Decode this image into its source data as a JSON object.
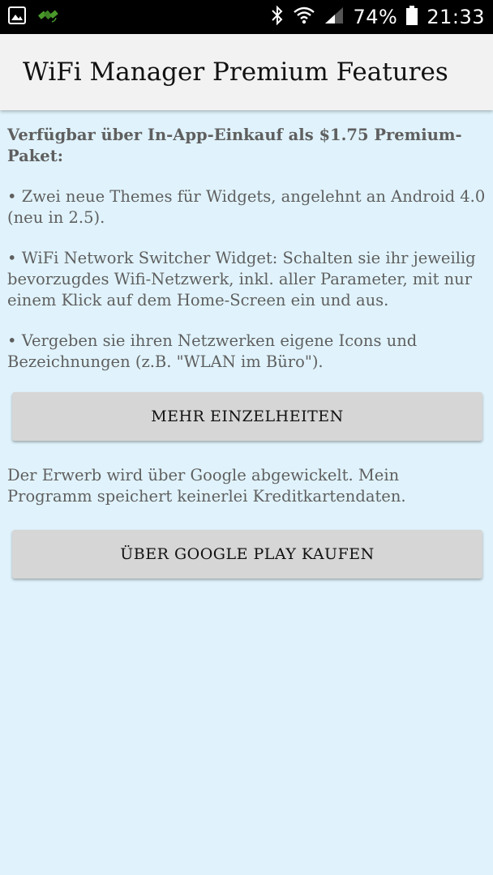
{
  "status_bar": {
    "icons_left": [
      "image-icon",
      "satellite-icon"
    ],
    "icons_right": [
      "bluetooth-icon",
      "wifi-icon",
      "signal-icon",
      "battery-icon"
    ],
    "battery": "74%",
    "time": "21:33"
  },
  "app_bar": {
    "title": "WiFi Manager Premium Features"
  },
  "content": {
    "intro": "Verfügbar über In-App-Einkauf als $1.75 Premium-Paket:",
    "features": [
      "• Zwei neue Themes für Widgets, angelehnt an Android 4.0 (neu in 2.5).",
      "• WiFi Network Switcher Widget: Schalten sie ihr jeweilig bevorzugdes Wifi-Netzwerk, inkl. aller Parameter, mit nur einem Klick auf dem Home-Screen ein und aus.",
      "• Vergeben sie ihren Netzwerken eigene Icons und Bezeichnungen (z.B. \"WLAN im Büro\")."
    ],
    "more_button": "MEHR EINZELHEITEN",
    "note": "Der Erwerb wird über Google abgewickelt. Mein Programm speichert keinerlei Kreditkartendaten.",
    "buy_button": "ÜBER GOOGLE PLAY KAUFEN"
  },
  "colors": {
    "background": "#e0f3fc",
    "app_bar": "#f2f2f2",
    "button": "#d6d6d6",
    "text": "#5f5f5f",
    "satellite_icon": "#4a9a2a"
  }
}
